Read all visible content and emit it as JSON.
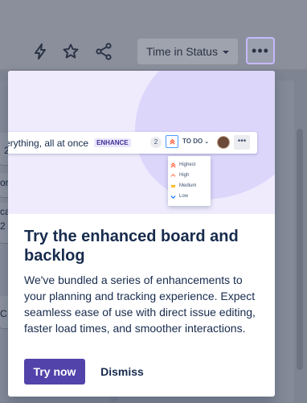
{
  "toolbar": {
    "lightning_icon": "lightning-icon",
    "star_icon": "star-icon",
    "share_icon": "share-icon",
    "time_in_status_label": "Time in Status",
    "more_label": "•••"
  },
  "background_fragments": {
    "frag_1": "2",
    "frag_2": "or",
    "frag_3": "ca",
    "frag_4": "2",
    "frag_5": "C"
  },
  "spotlight": {
    "hero": {
      "row_text": "erything, all at once",
      "tag": "ENHANCE",
      "count": "2",
      "status": "TO DO",
      "more": "•••",
      "priorities": [
        {
          "label": "Highest",
          "color": "#ff5630"
        },
        {
          "label": "High",
          "color": "#ff7452"
        },
        {
          "label": "Medium",
          "color": "#ffab00"
        },
        {
          "label": "Low",
          "color": "#0065ff"
        }
      ]
    },
    "title": "Try the enhanced board and backlog",
    "body": "We've bundled a series of enhancements to your planning and tracking experience. Expect seamless ease of use with direct issue editing, faster load times, and smoother interactions.",
    "primary_button": "Try now",
    "secondary_button": "Dismiss"
  },
  "colors": {
    "primary": "#5243aa",
    "hero_bg": "#efebfd",
    "focus_ring": "#c7b8ff"
  }
}
